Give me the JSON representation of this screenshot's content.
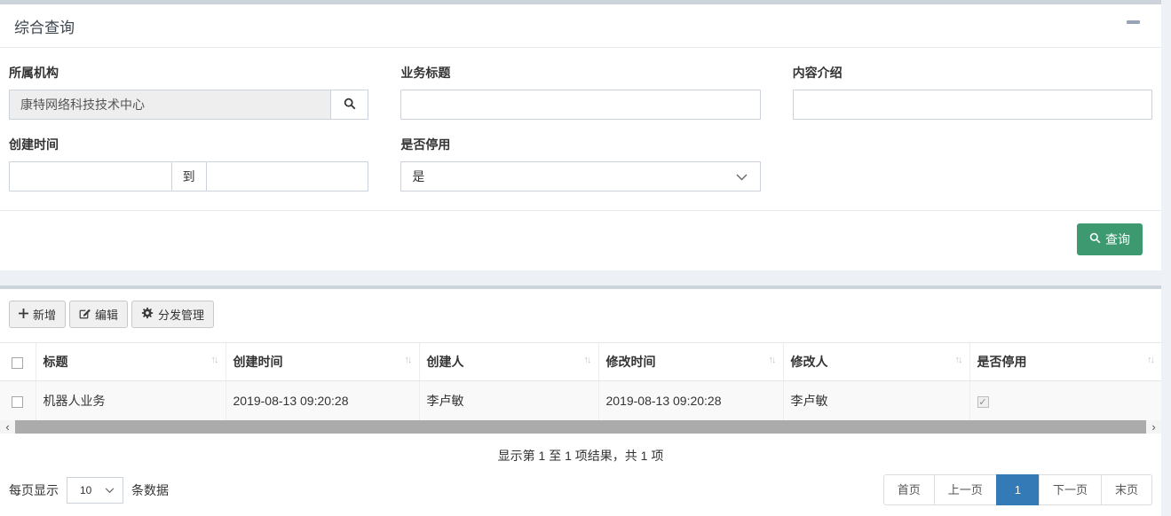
{
  "query": {
    "title": "综合查询",
    "fields": {
      "org": {
        "label": "所属机构",
        "value": "康特网络科技技术中心"
      },
      "biz_title": {
        "label": "业务标题",
        "value": ""
      },
      "content_intro": {
        "label": "内容介绍",
        "value": ""
      },
      "create_time": {
        "label": "创建时间",
        "from": "",
        "separator": "到",
        "to": ""
      },
      "is_disabled": {
        "label": "是否停用",
        "selected": "是"
      }
    },
    "search_button": "查询"
  },
  "toolbar": {
    "add_label": "新增",
    "edit_label": "编辑",
    "distribute_label": "分发管理"
  },
  "table": {
    "columns": [
      "标题",
      "创建时间",
      "创建人",
      "修改时间",
      "修改人",
      "是否停用"
    ],
    "rows": [
      {
        "title": "机器人业务",
        "created": "2019-08-13 09:20:28",
        "creator": "李卢敏",
        "modified": "2019-08-13 09:20:28",
        "modifier": "李卢敏",
        "disabled_checked": true
      }
    ]
  },
  "footer": {
    "summary": "显示第 1 至 1 项结果，共 1 项",
    "page_size_prefix": "每页显示",
    "page_size": "10",
    "page_size_suffix": "条数据",
    "pagination": {
      "first": "首页",
      "prev": "上一页",
      "current": "1",
      "next": "下一页",
      "last": "末页"
    }
  },
  "icons": {
    "sort_glyph": "↑↓",
    "check_glyph": "✓",
    "scroll_left": "‹",
    "scroll_right": "›"
  },
  "colors": {
    "accent_green": "#3d9970",
    "active_blue": "#337ab7",
    "strip_gray": "#ccd3da"
  }
}
